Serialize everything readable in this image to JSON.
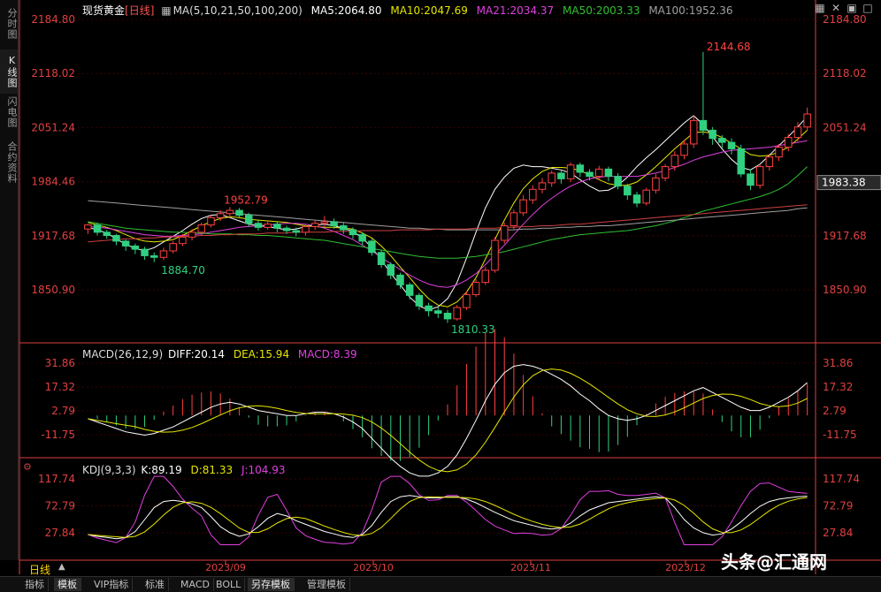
{
  "sidebar_tabs": [
    "分时图",
    "K线图",
    "闪电图",
    "合约资料"
  ],
  "title": "现货黄金",
  "period_tag": "[日线]",
  "ma_legend": {
    "label": "MA(5,10,21,50,100,200)",
    "items": [
      {
        "text": "MA5:2064.80",
        "color": "#ffffff"
      },
      {
        "text": "MA10:2047.69",
        "color": "#e6e600"
      },
      {
        "text": "MA21:2034.37",
        "color": "#e040e0"
      },
      {
        "text": "MA50:2003.33",
        "color": "#30c030"
      },
      {
        "text": "MA100:1952.36",
        "color": "#a0a0a0"
      }
    ]
  },
  "price_axis": [
    "2184.80",
    "2118.02",
    "2051.24",
    "1984.46",
    "1917.68",
    "1850.90"
  ],
  "current_price": "1983.38",
  "annotations": {
    "high": "2144.68",
    "swing_high": "1952.79",
    "swing_low": "1884.70",
    "low": "1810.33"
  },
  "macd_legend": {
    "label": "MACD(26,12,9)",
    "items": [
      {
        "text": "DIFF:20.14",
        "color": "#ffffff"
      },
      {
        "text": "DEA:15.94",
        "color": "#e6e600"
      },
      {
        "text": "MACD:8.39",
        "color": "#e040e0"
      }
    ]
  },
  "macd_axis": [
    "31.86",
    "17.32",
    "2.79",
    "-11.75"
  ],
  "kdj_legend": {
    "label": "KDJ(9,3,3)",
    "items": [
      {
        "text": "K:89.19",
        "color": "#ffffff"
      },
      {
        "text": "D:81.33",
        "color": "#e6e600"
      },
      {
        "text": "J:104.93",
        "color": "#e040e0"
      }
    ]
  },
  "kdj_axis": [
    "117.74",
    "72.79",
    "27.84"
  ],
  "time_axis": [
    "2023/09",
    "2023/10",
    "2023/11",
    "2023/12"
  ],
  "period_label": "日线",
  "toolbar": [
    "指标",
    "模板",
    "VIP指标",
    "标准",
    "MACD",
    "BOLL",
    "另存模板",
    "管理模板"
  ],
  "watermark": "头条@汇通网",
  "colors": {
    "up": "#ff4040",
    "down": "#30d080",
    "axis": "#e04040",
    "grid": "#3a0000"
  },
  "chart_data": {
    "type": "candlestick",
    "y_range": [
      1810.33,
      2184.8
    ],
    "series": [
      {
        "name": "MA5",
        "color": "#ffffff",
        "values": [
          1928,
          1925,
          1921,
          1914,
          1907,
          1902,
          1899,
          1903,
          1910,
          1917,
          1924,
          1932,
          1939,
          1943,
          1944,
          1940,
          1936,
          1932,
          1930,
          1929,
          1927,
          1925,
          1926,
          1929,
          1931,
          1932,
          1930,
          1927,
          1923,
          1915,
          1903,
          1888,
          1871,
          1857,
          1842,
          1831,
          1826,
          1830,
          1840,
          1860,
          1890,
          1922,
          1952,
          1975,
          1990,
          2001,
          2005,
          2003,
          2003,
          2001,
          1999,
          1995,
          1987,
          1979,
          1973,
          1974,
          1980,
          1990,
          2003,
          2014,
          2024,
          2035,
          2046,
          2057,
          2066,
          2055,
          2040,
          2025,
          2012,
          2002,
          1999,
          2006,
          2017,
          2029,
          2040,
          2052,
          2065
        ]
      },
      {
        "name": "MA10",
        "color": "#e6e600",
        "values": [
          1934,
          1931,
          1928,
          1924,
          1919,
          1914,
          1911,
          1910,
          1911,
          1913,
          1918,
          1924,
          1930,
          1935,
          1939,
          1941,
          1940,
          1938,
          1937,
          1936,
          1935,
          1934,
          1932,
          1930,
          1929,
          1928,
          1928,
          1927,
          1926,
          1921,
          1915,
          1905,
          1893,
          1879,
          1866,
          1852,
          1840,
          1832,
          1830,
          1836,
          1848,
          1866,
          1889,
          1913,
          1937,
          1958,
          1976,
          1988,
          1997,
          2002,
          2002,
          2001,
          1998,
          1993,
          1987,
          1982,
          1980,
          1980,
          1984,
          1993,
          2003,
          2014,
          2025,
          2035,
          2045,
          2046,
          2044,
          2039,
          2032,
          2025,
          2018,
          2016,
          2017,
          2021,
          2027,
          2037,
          2048
        ]
      },
      {
        "name": "MA21",
        "color": "#e040e0",
        "values": [
          1929,
          1928,
          1927,
          1925,
          1923,
          1921,
          1919,
          1918,
          1917,
          1917,
          1918,
          1919,
          1920,
          1922,
          1924,
          1926,
          1928,
          1929,
          1930,
          1931,
          1932,
          1933,
          1933,
          1932,
          1930,
          1927,
          1923,
          1918,
          1913,
          1906,
          1899,
          1891,
          1883,
          1876,
          1869,
          1863,
          1858,
          1855,
          1854,
          1857,
          1863,
          1871,
          1882,
          1894,
          1906,
          1919,
          1932,
          1944,
          1955,
          1964,
          1972,
          1979,
          1984,
          1988,
          1990,
          1991,
          1991,
          1991,
          1991,
          1993,
          1995,
          1998,
          2002,
          2006,
          2011,
          2015,
          2018,
          2021,
          2023,
          2024,
          2025,
          2026,
          2027,
          2029,
          2031,
          2033,
          2035
        ]
      },
      {
        "name": "MA50",
        "color": "#30c030",
        "values": [
          1935,
          1933,
          1931,
          1929,
          1927,
          1926,
          1925,
          1924,
          1923,
          1922,
          1922,
          1921,
          1921,
          1920,
          1920,
          1920,
          1919,
          1919,
          1918,
          1918,
          1917,
          1916,
          1915,
          1914,
          1913,
          1912,
          1910,
          1908,
          1906,
          1904,
          1902,
          1900,
          1898,
          1896,
          1894,
          1892,
          1891,
          1890,
          1890,
          1890,
          1891,
          1892,
          1894,
          1896,
          1898,
          1901,
          1904,
          1907,
          1910,
          1913,
          1915,
          1917,
          1919,
          1920,
          1921,
          1922,
          1923,
          1924,
          1926,
          1928,
          1930,
          1933,
          1936,
          1940,
          1944,
          1948,
          1951,
          1954,
          1957,
          1960,
          1963,
          1966,
          1970,
          1975,
          1982,
          1992,
          2003
        ]
      },
      {
        "name": "MA100",
        "color": "#a0a0a0",
        "values": [
          1961,
          1960,
          1959,
          1958,
          1957,
          1956,
          1955,
          1954,
          1953,
          1952,
          1951,
          1950,
          1949,
          1948,
          1947,
          1946,
          1945,
          1944,
          1943,
          1942,
          1941,
          1940,
          1939,
          1938,
          1937,
          1936,
          1935,
          1934,
          1933,
          1932,
          1931,
          1930,
          1929,
          1928,
          1927,
          1927,
          1926,
          1926,
          1925,
          1925,
          1925,
          1925,
          1925,
          1925,
          1925,
          1925,
          1926,
          1926,
          1927,
          1927,
          1928,
          1928,
          1929,
          1929,
          1930,
          1930,
          1931,
          1932,
          1933,
          1934,
          1935,
          1936,
          1937,
          1938,
          1939,
          1940,
          1941,
          1942,
          1943,
          1944,
          1945,
          1946,
          1947,
          1948,
          1949,
          1951,
          1952
        ]
      },
      {
        "name": "MA200",
        "color": "#d04040",
        "values": [
          1910,
          1911,
          1912,
          1913,
          1914,
          1914,
          1915,
          1915,
          1916,
          1916,
          1917,
          1917,
          1918,
          1918,
          1919,
          1919,
          1920,
          1920,
          1920,
          1921,
          1921,
          1921,
          1922,
          1922,
          1922,
          1922,
          1923,
          1923,
          1923,
          1924,
          1924,
          1924,
          1924,
          1925,
          1925,
          1925,
          1925,
          1926,
          1926,
          1926,
          1926,
          1927,
          1927,
          1927,
          1928,
          1928,
          1929,
          1929,
          1930,
          1930,
          1931,
          1932,
          1932,
          1933,
          1934,
          1935,
          1936,
          1937,
          1938,
          1939,
          1940,
          1941,
          1942,
          1943,
          1944,
          1945,
          1946,
          1947,
          1948,
          1949,
          1950,
          1951,
          1952,
          1953,
          1954,
          1955,
          1956
        ]
      }
    ],
    "candles": [
      [
        1926,
        1931,
        1920,
        1932
      ],
      [
        1931,
        1922,
        1918,
        1934
      ],
      [
        1922,
        1918,
        1914,
        1925
      ],
      [
        1918,
        1911,
        1906,
        1920
      ],
      [
        1911,
        1905,
        1899,
        1913
      ],
      [
        1905,
        1901,
        1895,
        1908
      ],
      [
        1901,
        1893,
        1888,
        1904
      ],
      [
        1893,
        1891,
        1885,
        1897
      ],
      [
        1891,
        1899,
        1888,
        1903
      ],
      [
        1899,
        1908,
        1896,
        1911
      ],
      [
        1908,
        1916,
        1905,
        1920
      ],
      [
        1916,
        1922,
        1912,
        1926
      ],
      [
        1922,
        1931,
        1918,
        1934
      ],
      [
        1931,
        1940,
        1928,
        1943
      ],
      [
        1940,
        1945,
        1936,
        1949
      ],
      [
        1945,
        1949,
        1940,
        1953
      ],
      [
        1949,
        1943,
        1939,
        1952
      ],
      [
        1943,
        1933,
        1929,
        1946
      ],
      [
        1933,
        1928,
        1924,
        1937
      ],
      [
        1928,
        1932,
        1925,
        1936
      ],
      [
        1932,
        1927,
        1922,
        1935
      ],
      [
        1927,
        1924,
        1920,
        1930
      ],
      [
        1924,
        1922,
        1917,
        1928
      ],
      [
        1922,
        1929,
        1918,
        1932
      ],
      [
        1929,
        1933,
        1925,
        1937
      ],
      [
        1933,
        1935,
        1929,
        1942
      ],
      [
        1935,
        1930,
        1926,
        1939
      ],
      [
        1930,
        1925,
        1920,
        1934
      ],
      [
        1925,
        1919,
        1914,
        1928
      ],
      [
        1919,
        1911,
        1906,
        1922
      ],
      [
        1911,
        1897,
        1893,
        1914
      ],
      [
        1897,
        1882,
        1878,
        1900
      ],
      [
        1882,
        1869,
        1864,
        1885
      ],
      [
        1869,
        1857,
        1852,
        1872
      ],
      [
        1857,
        1844,
        1839,
        1860
      ],
      [
        1844,
        1831,
        1826,
        1847
      ],
      [
        1831,
        1825,
        1818,
        1835
      ],
      [
        1825,
        1822,
        1816,
        1829
      ],
      [
        1822,
        1815,
        1810,
        1826
      ],
      [
        1815,
        1829,
        1813,
        1832
      ],
      [
        1829,
        1845,
        1826,
        1849
      ],
      [
        1845,
        1860,
        1842,
        1864
      ],
      [
        1860,
        1875,
        1857,
        1879
      ],
      [
        1875,
        1912,
        1872,
        1916
      ],
      [
        1912,
        1930,
        1908,
        1934
      ],
      [
        1930,
        1946,
        1926,
        1950
      ],
      [
        1946,
        1962,
        1942,
        1968
      ],
      [
        1962,
        1975,
        1957,
        1980
      ],
      [
        1975,
        1983,
        1970,
        1989
      ],
      [
        1983,
        1995,
        1978,
        1998
      ],
      [
        1995,
        1988,
        1982,
        1999
      ],
      [
        1988,
        2005,
        1984,
        2008
      ],
      [
        2005,
        1996,
        1990,
        2008
      ],
      [
        1996,
        1991,
        1986,
        2000
      ],
      [
        1991,
        2000,
        1986,
        2004
      ],
      [
        2000,
        1991,
        1985,
        2003
      ],
      [
        1991,
        1979,
        1975,
        1995
      ],
      [
        1979,
        1968,
        1962,
        1982
      ],
      [
        1968,
        1958,
        1953,
        1972
      ],
      [
        1958,
        1974,
        1955,
        1977
      ],
      [
        1974,
        1989,
        1970,
        1994
      ],
      [
        1989,
        2003,
        1985,
        2006
      ],
      [
        2003,
        2017,
        1998,
        2022
      ],
      [
        2017,
        2031,
        2012,
        2036
      ],
      [
        2031,
        2060,
        2026,
        2066
      ],
      [
        2060,
        2048,
        2042,
        2144.68
      ],
      [
        2048,
        2038,
        2030,
        2052
      ],
      [
        2038,
        2033,
        2026,
        2042
      ],
      [
        2033,
        2025,
        2018,
        2038
      ],
      [
        2025,
        1994,
        1990,
        2030
      ],
      [
        1994,
        1980,
        1974,
        2000
      ],
      [
        1980,
        2003,
        1976,
        2006
      ],
      [
        2003,
        2015,
        1998,
        2019
      ],
      [
        2015,
        2027,
        2010,
        2031
      ],
      [
        2027,
        2039,
        2022,
        2043
      ],
      [
        2039,
        2052,
        2034,
        2058
      ],
      [
        2052,
        2068,
        2047,
        2076
      ]
    ],
    "macd": {
      "diff": [
        -2,
        -4,
        -6,
        -8,
        -10,
        -11,
        -12,
        -11,
        -9,
        -7,
        -4,
        -1,
        2,
        5,
        7,
        8,
        7,
        5,
        3,
        2,
        1,
        0,
        0,
        1,
        2,
        2,
        1,
        -1,
        -4,
        -8,
        -14,
        -20,
        -26,
        -31,
        -35,
        -37,
        -37,
        -35,
        -31,
        -24,
        -14,
        -3,
        9,
        19,
        26,
        30,
        31,
        30,
        28,
        25,
        22,
        18,
        13,
        9,
        4,
        0,
        -2,
        -3,
        -2,
        0,
        3,
        6,
        9,
        12,
        15,
        17,
        14,
        11,
        8,
        5,
        3,
        3,
        5,
        8,
        11,
        15,
        20
      ]
    },
    "kdj": {
      "k": [
        25,
        22,
        20,
        18,
        20,
        30,
        50,
        70,
        80,
        82,
        80,
        76,
        70,
        55,
        38,
        28,
        22,
        26,
        38,
        52,
        60,
        56,
        48,
        42,
        36,
        30,
        26,
        22,
        20,
        25,
        40,
        62,
        80,
        88,
        90,
        88,
        86,
        86,
        88,
        88,
        84,
        78,
        70,
        62,
        55,
        48,
        44,
        40,
        36,
        34,
        36,
        44,
        56,
        66,
        72,
        78,
        80,
        82,
        84,
        86,
        88,
        86,
        70,
        50,
        36,
        28,
        24,
        26,
        34,
        46,
        60,
        72,
        80,
        84,
        86,
        88,
        89
      ]
    }
  }
}
